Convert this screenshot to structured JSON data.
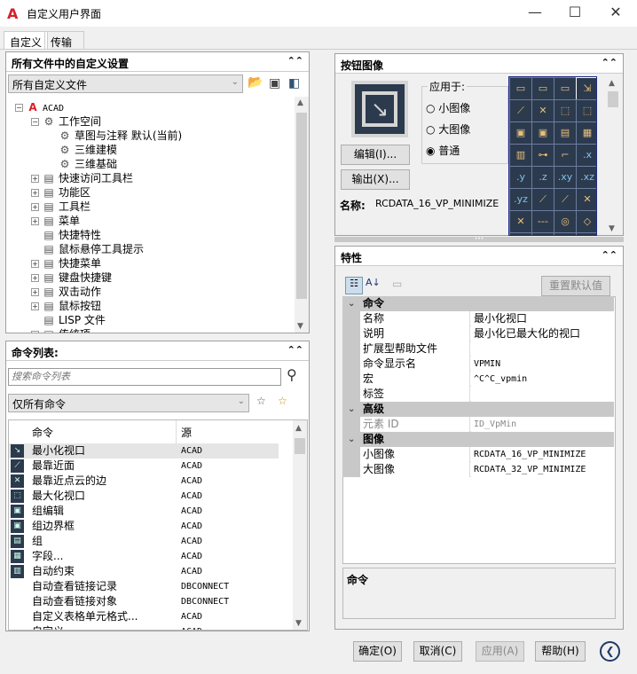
{
  "window": {
    "title": "自定义用户界面",
    "minimize": "—",
    "maximize": "☐",
    "close": "✕"
  },
  "tabs": [
    {
      "label": "自定义"
    },
    {
      "label": "传输"
    }
  ],
  "customizations": {
    "title": "所有文件中的自定义设置",
    "file_select": "所有自定义文件",
    "tree": [
      {
        "label": "ACAD",
        "level": 0,
        "exp": "−"
      },
      {
        "label": "工作空间",
        "level": 1,
        "exp": "−"
      },
      {
        "label": "草图与注释 默认(当前)",
        "level": 2
      },
      {
        "label": "三维建模",
        "level": 2
      },
      {
        "label": "三维基础",
        "level": 2
      },
      {
        "label": "快速访问工具栏",
        "level": 1,
        "exp": "+"
      },
      {
        "label": "功能区",
        "level": 1,
        "exp": "+"
      },
      {
        "label": "工具栏",
        "level": 1,
        "exp": "+"
      },
      {
        "label": "菜单",
        "level": 1,
        "exp": "+"
      },
      {
        "label": "快捷特性",
        "level": 1
      },
      {
        "label": "鼠标悬停工具提示",
        "level": 1
      },
      {
        "label": "快捷菜单",
        "level": 1,
        "exp": "+"
      },
      {
        "label": "键盘快捷键",
        "level": 1,
        "exp": "+"
      },
      {
        "label": "双击动作",
        "level": 1,
        "exp": "+"
      },
      {
        "label": "鼠标按钮",
        "level": 1,
        "exp": "+"
      },
      {
        "label": "LISP 文件",
        "level": 1
      },
      {
        "label": "传统项",
        "level": 1,
        "exp": "+"
      }
    ]
  },
  "command_list": {
    "title": "命令列表:",
    "search_placeholder": "搜索命令列表",
    "filter": "仅所有命令",
    "col_command": "命令",
    "col_source": "源",
    "rows": [
      {
        "name": "最小化视口",
        "source": "ACAD"
      },
      {
        "name": "最靠近面",
        "source": "ACAD"
      },
      {
        "name": "最靠近点云的边",
        "source": "ACAD"
      },
      {
        "name": "最大化视口",
        "source": "ACAD"
      },
      {
        "name": "组编辑",
        "source": "ACAD"
      },
      {
        "name": "组边界框",
        "source": "ACAD"
      },
      {
        "name": "组",
        "source": "ACAD"
      },
      {
        "name": "字段...",
        "source": "ACAD"
      },
      {
        "name": "自动约束",
        "source": "ACAD"
      },
      {
        "name": "自动查看链接记录",
        "source": "DBCONNECT"
      },
      {
        "name": "自动查看链接对象",
        "source": "DBCONNECT"
      },
      {
        "name": "自定义表格单元格式...",
        "source": "ACAD"
      },
      {
        "name": "自定义...",
        "source": "ACAD"
      }
    ]
  },
  "button_image": {
    "title": "按钮图像",
    "apply_to": "应用于:",
    "options": [
      "小图像",
      "大图像",
      "普通"
    ],
    "selected": 2,
    "edit": "编辑(I)...",
    "export": "输出(X)...",
    "name_label": "名称:",
    "name_value": "RCDATA_16_VP_MINIMIZE",
    "grid": [
      "▭",
      "▭",
      "▭",
      "⇲",
      "⟋",
      "✕",
      "⬚",
      "⬚",
      "▣",
      "▣",
      "▤",
      "▦",
      "▥",
      "⊶",
      "⌐",
      ".x",
      ".y",
      ".z",
      ".xy",
      ".xz",
      ".yz",
      "⟋",
      "⟋",
      "✕",
      "✕",
      "---",
      "◎",
      "◇",
      "◔",
      "┴",
      "⫽",
      "·"
    ]
  },
  "properties": {
    "title": "特性",
    "reset": "重置默认值",
    "categories": [
      {
        "name": "命令",
        "rows": [
          {
            "k": "名称",
            "v": "最小化视口"
          },
          {
            "k": "说明",
            "v": "最小化已最大化的视口"
          },
          {
            "k": "扩展型帮助文件",
            "v": ""
          },
          {
            "k": "命令显示名",
            "v": "VPMIN",
            "mono": true
          },
          {
            "k": "宏",
            "v": "^C^C_vpmin",
            "mono": true
          },
          {
            "k": "标签",
            "v": ""
          }
        ]
      },
      {
        "name": "高级",
        "rows": [
          {
            "k": "元素 ID",
            "v": "ID_VpMin",
            "mono": true,
            "dim": true
          }
        ]
      },
      {
        "name": "图像",
        "rows": [
          {
            "k": "小图像",
            "v": "RCDATA_16_VP_MINIMIZE",
            "mono": true
          },
          {
            "k": "大图像",
            "v": "RCDATA_32_VP_MINIMIZE",
            "mono": true
          }
        ]
      }
    ],
    "description_title": "命令"
  },
  "footer": {
    "ok": "确定(O)",
    "cancel": "取消(C)",
    "apply": "应用(A)",
    "help": "帮助(H)"
  }
}
